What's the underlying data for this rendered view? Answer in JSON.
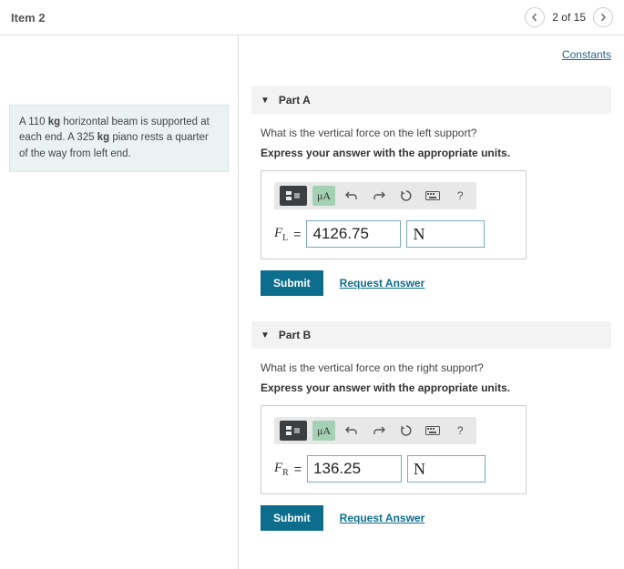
{
  "header": {
    "title": "Item 2",
    "position": "2 of 15"
  },
  "links": {
    "constants": "Constants"
  },
  "problem": {
    "text_1": "A 110 ",
    "mass_unit_1": "kg",
    "text_2": " horizontal beam is supported at each end. A 325 ",
    "mass_unit_2": "kg",
    "text_3": " piano rests a quarter of the way from left end."
  },
  "labels": {
    "submit": "Submit",
    "request_answer": "Request Answer",
    "tool_mu": "μA",
    "tool_help": "?",
    "equals": "="
  },
  "parts": [
    {
      "title": "Part A",
      "question": "What is the vertical force on the left support?",
      "instruct": "Express your answer with the appropriate units.",
      "var_main": "F",
      "var_sub": "L",
      "value": "4126.75",
      "unit": "N"
    },
    {
      "title": "Part B",
      "question": "What is the vertical force on the right support?",
      "instruct": "Express your answer with the appropriate units.",
      "var_main": "F",
      "var_sub": "R",
      "value": "136.25",
      "unit": "N"
    }
  ]
}
